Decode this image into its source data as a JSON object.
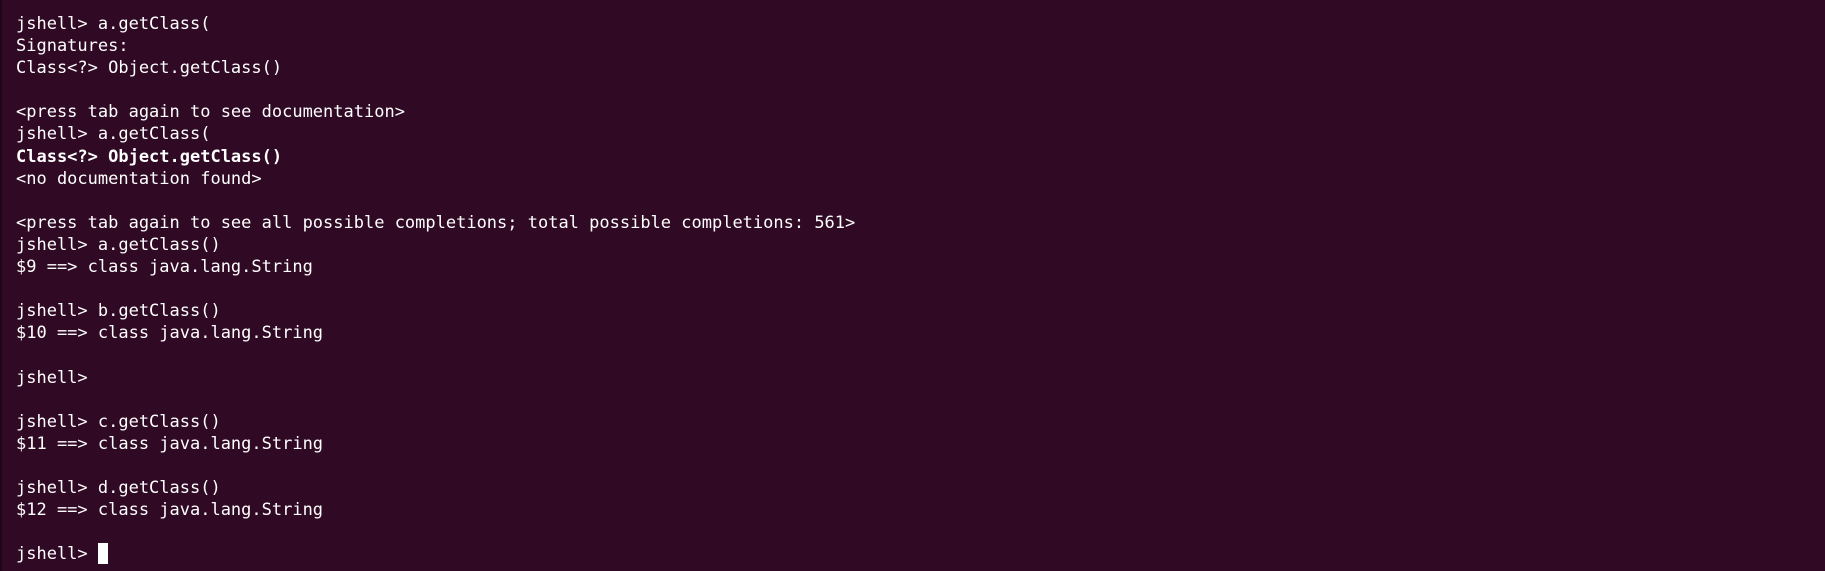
{
  "terminal": {
    "lines": [
      {
        "text": "jshell> a.getClass(",
        "bold": false
      },
      {
        "text": "Signatures:",
        "bold": false
      },
      {
        "text": "Class<?> Object.getClass()",
        "bold": false
      },
      {
        "text": "",
        "bold": false
      },
      {
        "text": "<press tab again to see documentation>",
        "bold": false
      },
      {
        "text": "jshell> a.getClass(",
        "bold": false
      },
      {
        "text": "Class<?> Object.getClass()",
        "bold": true
      },
      {
        "text": "<no documentation found>",
        "bold": false
      },
      {
        "text": "",
        "bold": false
      },
      {
        "text": "<press tab again to see all possible completions; total possible completions: 561>",
        "bold": false
      },
      {
        "text": "jshell> a.getClass()",
        "bold": false
      },
      {
        "text": "$9 ==> class java.lang.String",
        "bold": false
      },
      {
        "text": "",
        "bold": false
      },
      {
        "text": "jshell> b.getClass()",
        "bold": false
      },
      {
        "text": "$10 ==> class java.lang.String",
        "bold": false
      },
      {
        "text": "",
        "bold": false
      },
      {
        "text": "jshell>",
        "bold": false
      },
      {
        "text": "",
        "bold": false
      },
      {
        "text": "jshell> c.getClass()",
        "bold": false
      },
      {
        "text": "$11 ==> class java.lang.String",
        "bold": false
      },
      {
        "text": "",
        "bold": false
      },
      {
        "text": "jshell> d.getClass()",
        "bold": false
      },
      {
        "text": "$12 ==> class java.lang.String",
        "bold": false
      },
      {
        "text": "",
        "bold": false
      }
    ],
    "prompt": "jshell> ",
    "colors": {
      "background": "#300a24",
      "foreground": "#ffffff"
    }
  }
}
